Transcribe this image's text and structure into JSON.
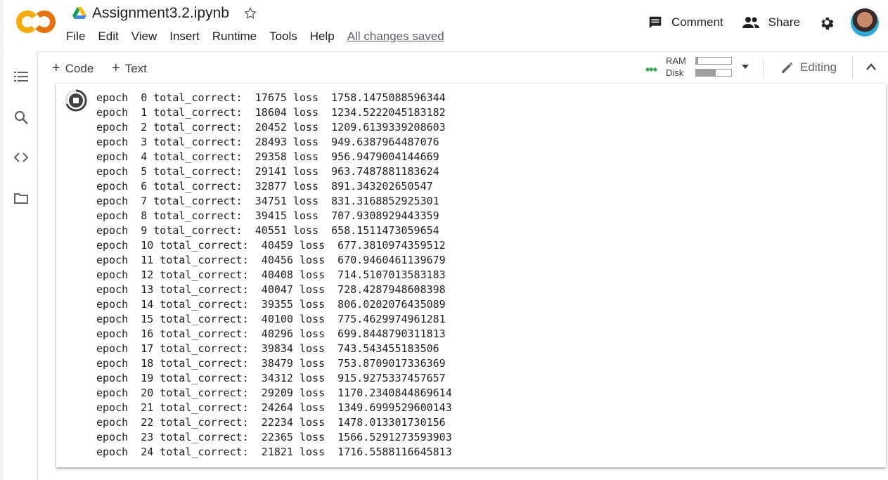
{
  "notebook": {
    "title": "Assignment3.2.ipynb",
    "save_status": "All changes saved"
  },
  "menu": [
    "File",
    "Edit",
    "View",
    "Insert",
    "Runtime",
    "Tools",
    "Help"
  ],
  "header_actions": {
    "comment": "Comment",
    "share": "Share"
  },
  "toolbar": {
    "code": "Code",
    "text": "Text",
    "ram_label": "RAM",
    "disk_label": "Disk",
    "ram_usage": 0.05,
    "disk_usage": 0.55,
    "editing": "Editing"
  },
  "brand_colors": {
    "colab_orange": "#f9ab00",
    "colab_dark_orange": "#e8710a",
    "connected_green": "#34a853"
  },
  "icons": [
    "colab-logo",
    "drive-icon",
    "star-icon",
    "comment-icon",
    "share-icon",
    "gear-icon",
    "toc-icon",
    "search-icon",
    "code-snippets-icon",
    "folder-icon",
    "pencil-icon",
    "chevron-up-icon",
    "dropdown-icon",
    "stop-icon"
  ],
  "output": {
    "lines": [
      "epoch  0 total_correct:  17675 loss  1758.1475088596344",
      "epoch  1 total_correct:  18604 loss  1234.5222045183182",
      "epoch  2 total_correct:  20452 loss  1209.6139339208603",
      "epoch  3 total_correct:  28493 loss  949.6387964487076",
      "epoch  4 total_correct:  29358 loss  956.9479004144669",
      "epoch  5 total_correct:  29141 loss  963.7487881183624",
      "epoch  6 total_correct:  32877 loss  891.343202650547",
      "epoch  7 total_correct:  34751 loss  831.3168852925301",
      "epoch  8 total_correct:  39415 loss  707.9308929443359",
      "epoch  9 total_correct:  40551 loss  658.1511473059654",
      "epoch  10 total_correct:  40459 loss  677.3810974359512",
      "epoch  11 total_correct:  40456 loss  670.9460461139679",
      "epoch  12 total_correct:  40408 loss  714.5107013583183",
      "epoch  13 total_correct:  40047 loss  728.4287948608398",
      "epoch  14 total_correct:  39355 loss  806.0202076435089",
      "epoch  15 total_correct:  40100 loss  775.4629974961281",
      "epoch  16 total_correct:  40296 loss  699.8448790311813",
      "epoch  17 total_correct:  39834 loss  743.543455183506",
      "epoch  18 total_correct:  38479 loss  753.8709017336369",
      "epoch  19 total_correct:  34312 loss  915.9275337457657",
      "epoch  20 total_correct:  29209 loss  1170.2340844869614",
      "epoch  21 total_correct:  24264 loss  1349.6999529600143",
      "epoch  22 total_correct:  22234 loss  1478.013301730156",
      "epoch  23 total_correct:  22365 loss  1566.5291273593903",
      "epoch  24 total_correct:  21821 loss  1716.5588116645813"
    ]
  }
}
